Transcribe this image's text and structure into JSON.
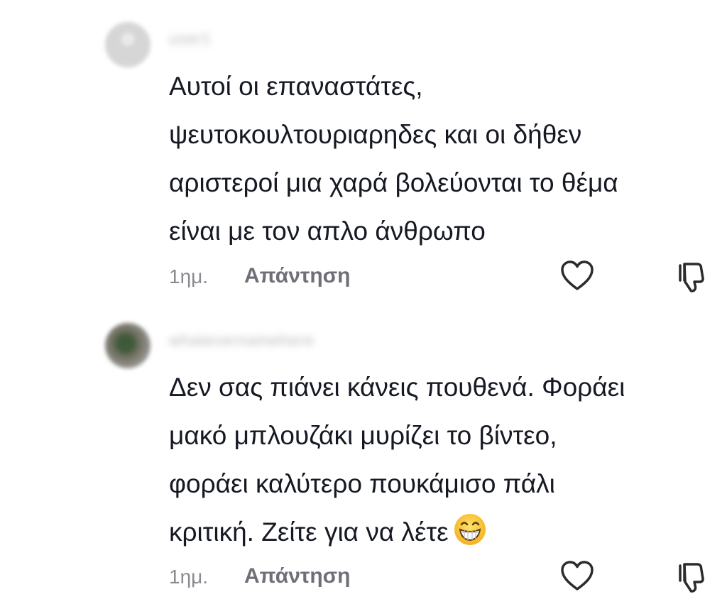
{
  "comments": [
    {
      "username": "user1",
      "text": "Αυτοί οι επαναστάτες,\nψευτοκουλτουριαρηδες και οι δήθεν\nαριστεροί μια χαρά βολεύονται το θέμα\nείναι με τον απλο άνθρωπο",
      "time": "1ημ.",
      "reply_label": "Απάντηση",
      "emoji": ""
    },
    {
      "username": "whatevernamehere",
      "text": "Δεν σας πιάνει κάνεις πουθενά. Φοράει\nμακό μπλουζάκι μυρίζει το βίντεο,\nφοράει καλύτερο πουκάμισο πάλι\nκριτική. Ζείτε για να λέτε",
      "time": "1ημ.",
      "reply_label": "Απάντηση",
      "emoji": "grinning-face-emoji"
    }
  ],
  "colors": {
    "text": "#161823",
    "muted": "#8a8b91",
    "reply": "#6f7077",
    "icon": "#2b2b2b"
  }
}
